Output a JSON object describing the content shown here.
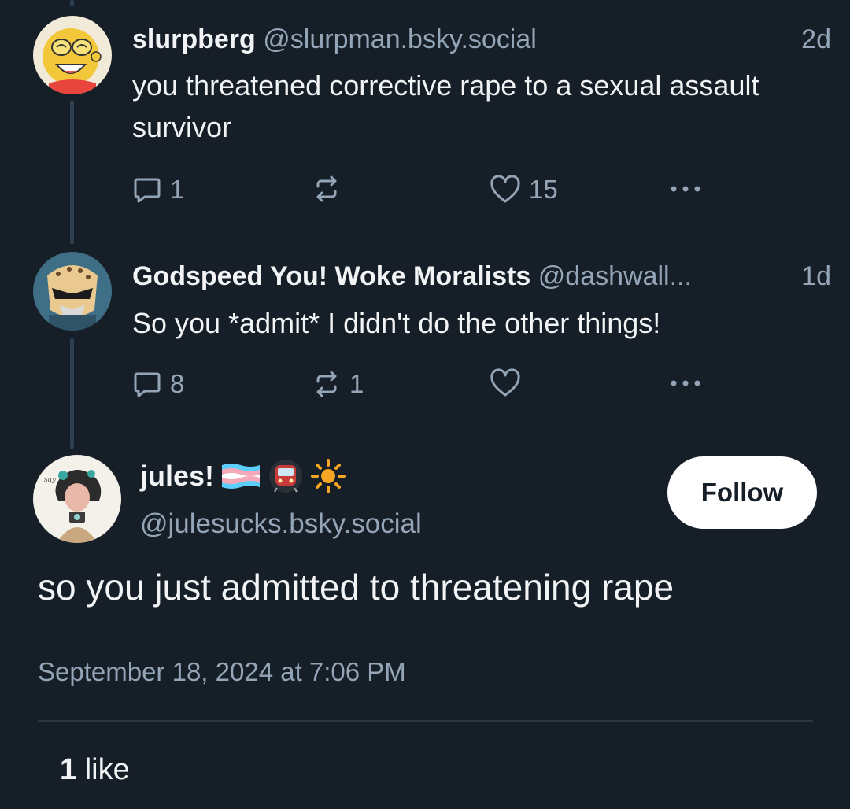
{
  "posts": [
    {
      "display_name": "slurpberg",
      "handle": "@slurpman.bsky.social",
      "time": "2d",
      "text": "you threatened corrective rape to a sexual assault survivor",
      "reply_count": "1",
      "repost_count": "",
      "like_count": "15"
    },
    {
      "display_name": "Godspeed You! Woke Moralists",
      "handle": "@dashwall...",
      "time": "1d",
      "text": "So you *admit* I didn't do the other things!",
      "reply_count": "8",
      "repost_count": "1",
      "like_count": ""
    }
  ],
  "focus_post": {
    "display_name": "jules!",
    "name_icons": [
      "trans-flag-icon",
      "metro-train-icon",
      "sun-icon"
    ],
    "handle": "@julesucks.bsky.social",
    "follow_label": "Follow",
    "text": "so you just admitted to threatening rape",
    "date": "September 18, 2024 at 7:06 PM",
    "like_count": "1",
    "like_label": "like"
  },
  "colors": {
    "background": "#161e27",
    "text": "#f1f3f5",
    "muted": "#93a5b7",
    "thread_line": "#2e4153",
    "follow_bg": "#ffffff"
  }
}
